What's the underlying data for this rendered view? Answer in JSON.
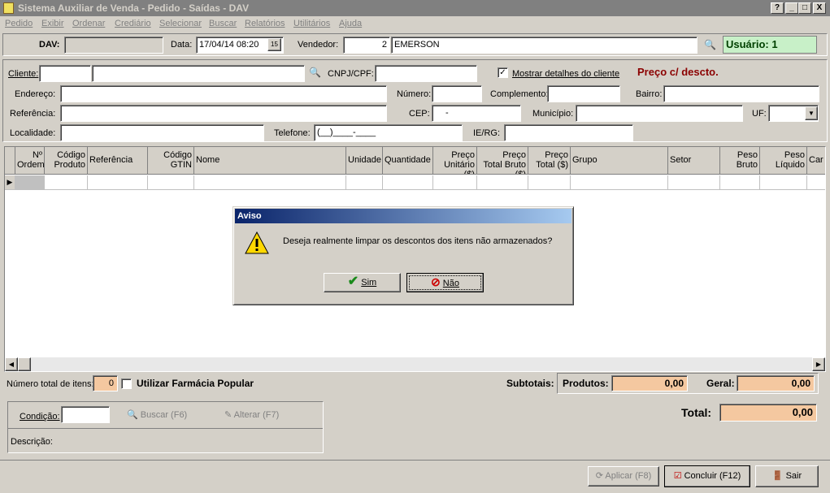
{
  "window": {
    "title": "Sistema Auxiliar de Venda - Pedido - Saídas - DAV",
    "help_btn": "?",
    "min_btn": "_",
    "max_btn": "□",
    "close_btn": "X"
  },
  "menu": [
    "Pedido",
    "Exibir",
    "Ordenar",
    "Crediário",
    "Selecionar",
    "Buscar",
    "Relatórios",
    "Utilitários",
    "Ajuda"
  ],
  "header": {
    "dav_label": "DAV:",
    "dav_value": "",
    "data_label": "Data:",
    "data_value": "17/04/14 08:20",
    "cal_btn": "15",
    "vendedor_label": "Vendedor:",
    "vendedor_code": "2",
    "vendedor_name": "EMERSON",
    "usuario": "Usuário: 1"
  },
  "client": {
    "cliente_label": "Cliente:",
    "cliente_code": "",
    "cliente_name": "",
    "cnpj_label": "CNPJ/CPF:",
    "cnpj_value": "",
    "mostrar_label": "Mostrar detalhes do cliente",
    "mostrar_checked": "✓",
    "preco_label": "Preço c/ descto.",
    "endereco_label": "Endereço:",
    "numero_label": "Número:",
    "complemento_label": "Complemento:",
    "bairro_label": "Bairro:",
    "referencia_label": "Referência:",
    "cep_label": "CEP:",
    "cep_value": "-",
    "municipio_label": "Município:",
    "uf_label": "UF:",
    "localidade_label": "Localidade:",
    "telefone_label": "Telefone:",
    "telefone_value": "(__)____-____",
    "ierg_label": "IE/RG:"
  },
  "grid": {
    "columns": [
      [
        "Nº",
        "Ordem"
      ],
      [
        "Código",
        "Produto"
      ],
      [
        "Referência"
      ],
      [
        "Código",
        "GTIN"
      ],
      [
        "Nome"
      ],
      [
        "Unidade"
      ],
      [
        "Quantidade"
      ],
      [
        "Preço",
        "Unitário ($)"
      ],
      [
        "Preço",
        "Total Bruto ($)"
      ],
      [
        "Preço",
        "Total ($)"
      ],
      [
        "Grupo"
      ],
      [
        "Setor"
      ],
      [
        "Peso",
        "Bruto"
      ],
      [
        "Peso",
        "Líquido"
      ],
      [
        "Car"
      ]
    ]
  },
  "dialog": {
    "title": "Aviso",
    "message": "Deseja realmente limpar os descontos dos itens não armazenados?",
    "yes": "Sim",
    "no": "Não"
  },
  "footer": {
    "num_itens_label": "Número total de itens:",
    "num_itens_value": "0",
    "farmacia_label": "Utilizar Farmácia Popular",
    "subtotais_label": "Subtotais:",
    "produtos_label": "Produtos:",
    "produtos_value": "0,00",
    "geral_label": "Geral:",
    "geral_value": "0,00",
    "condicao_label": "Condição:",
    "buscar_btn": "Buscar (F6)",
    "alterar_btn": "Alterar (F7)",
    "descricao_label": "Descrição:",
    "total_label": "Total:",
    "total_value": "0,00",
    "aplicar_btn": "Aplicar (F8)",
    "concluir_btn": "Concluir (F12)",
    "sair_btn": "Sair"
  }
}
